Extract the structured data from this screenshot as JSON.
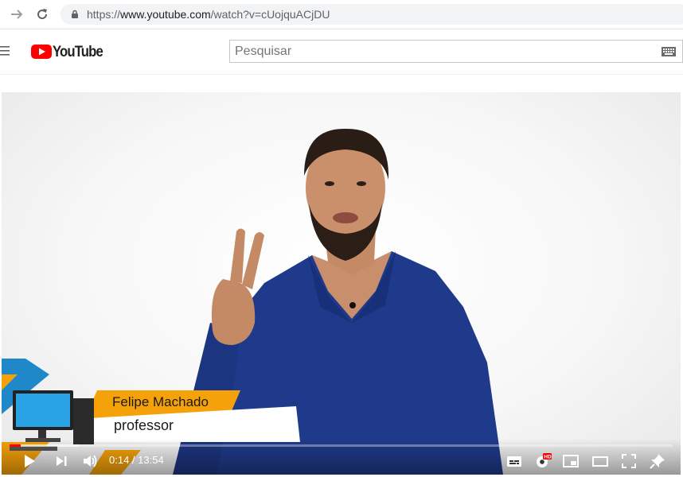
{
  "browser": {
    "url_scheme": "https://",
    "url_host": "www.youtube.com",
    "url_path": "/watch?v=cUojquACjDU"
  },
  "header": {
    "logo_text": "YouTube",
    "search_placeholder": "Pesquisar"
  },
  "video": {
    "lower_third_name": "Felipe Machado",
    "lower_third_role": "professor",
    "current_time": "0:14",
    "duration": "13:54",
    "time_separator": " / ",
    "progress_fraction": 0.017,
    "buffered_fraction": 0.105
  },
  "colors": {
    "brand_red": "#ff0000",
    "shirt_blue": "#1f3a8a",
    "banner_orange": "#f5a20a",
    "banner_blue": "#1e88c9"
  },
  "icons": {
    "forward": "arrow-right-icon",
    "reload": "reload-icon",
    "lock": "lock-icon",
    "menu": "hamburger-menu-icon",
    "keyboard": "keyboard-icon",
    "play": "play-icon",
    "next": "next-icon",
    "volume": "volume-icon",
    "subtitles": "subtitles-icon",
    "settings": "settings-hd-icon",
    "miniplayer": "miniplayer-icon",
    "theater": "theater-mode-icon",
    "fullscreen": "fullscreen-icon",
    "pin": "pin-icon"
  }
}
